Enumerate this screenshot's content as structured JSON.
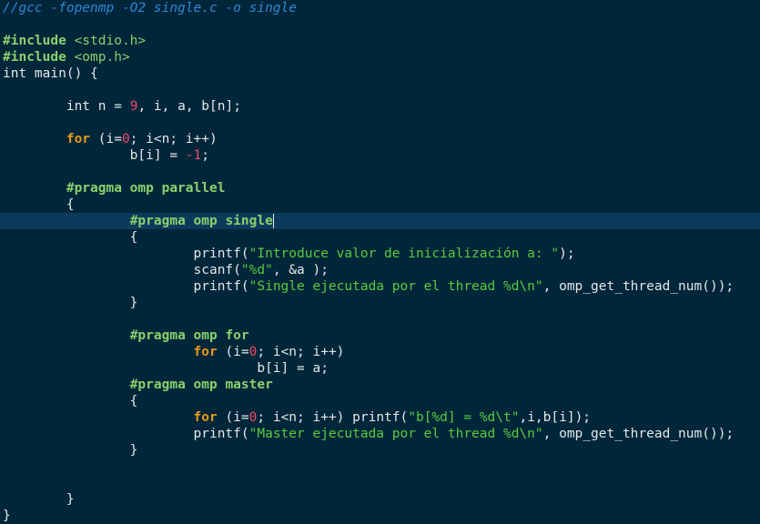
{
  "editor": {
    "lines": [
      [
        {
          "c": "comment",
          "t": "//gcc -fopenmp -O2 single.c -o single"
        }
      ],
      [],
      [
        {
          "c": "pre",
          "t": "#include "
        },
        {
          "c": "include-path",
          "t": "<stdio.h>"
        }
      ],
      [
        {
          "c": "pre",
          "t": "#include "
        },
        {
          "c": "include-path",
          "t": "<omp.h>"
        }
      ],
      [
        {
          "c": "type",
          "t": "int"
        },
        {
          "c": "plain",
          "t": " main() {"
        }
      ],
      [],
      [
        {
          "c": "plain",
          "t": "        "
        },
        {
          "c": "type",
          "t": "int"
        },
        {
          "c": "plain",
          "t": " n = "
        },
        {
          "c": "num",
          "t": "9"
        },
        {
          "c": "plain",
          "t": ", i, a, b[n];"
        }
      ],
      [],
      [
        {
          "c": "plain",
          "t": "        "
        },
        {
          "c": "kw",
          "t": "for"
        },
        {
          "c": "plain",
          "t": " (i="
        },
        {
          "c": "num",
          "t": "0"
        },
        {
          "c": "plain",
          "t": "; i<n; i++)"
        }
      ],
      [
        {
          "c": "plain",
          "t": "                b[i] = "
        },
        {
          "c": "num",
          "t": "-1"
        },
        {
          "c": "plain",
          "t": ";"
        }
      ],
      [],
      [
        {
          "c": "plain",
          "t": "        "
        },
        {
          "c": "pre",
          "t": "#pragma omp parallel"
        }
      ],
      [
        {
          "c": "plain",
          "t": "        {"
        }
      ],
      [
        {
          "c": "plain",
          "t": "                "
        },
        {
          "c": "pre",
          "t": "#pragma omp single"
        }
      ],
      [
        {
          "c": "plain",
          "t": "                {"
        }
      ],
      [
        {
          "c": "plain",
          "t": "                        printf("
        },
        {
          "c": "str",
          "t": "\"Introduce valor de inicialización a: \""
        },
        {
          "c": "plain",
          "t": ");"
        }
      ],
      [
        {
          "c": "plain",
          "t": "                        scanf("
        },
        {
          "c": "str",
          "t": "\"%d\""
        },
        {
          "c": "plain",
          "t": ", &a );"
        }
      ],
      [
        {
          "c": "plain",
          "t": "                        printf("
        },
        {
          "c": "str",
          "t": "\"Single ejecutada por el thread %d\\n\""
        },
        {
          "c": "plain",
          "t": ", omp_get_thread_num());"
        }
      ],
      [
        {
          "c": "plain",
          "t": "                }"
        }
      ],
      [],
      [
        {
          "c": "plain",
          "t": "                "
        },
        {
          "c": "pre",
          "t": "#pragma omp for"
        }
      ],
      [
        {
          "c": "plain",
          "t": "                        "
        },
        {
          "c": "kw",
          "t": "for"
        },
        {
          "c": "plain",
          "t": " (i="
        },
        {
          "c": "num",
          "t": "0"
        },
        {
          "c": "plain",
          "t": "; i<n; i++)"
        }
      ],
      [
        {
          "c": "plain",
          "t": "                                b[i] = a;"
        }
      ],
      [
        {
          "c": "plain",
          "t": "                "
        },
        {
          "c": "pre",
          "t": "#pragma omp master"
        }
      ],
      [
        {
          "c": "plain",
          "t": "                {"
        }
      ],
      [
        {
          "c": "plain",
          "t": "                        "
        },
        {
          "c": "kw",
          "t": "for"
        },
        {
          "c": "plain",
          "t": " (i="
        },
        {
          "c": "num",
          "t": "0"
        },
        {
          "c": "plain",
          "t": "; i<n; i++) printf("
        },
        {
          "c": "str",
          "t": "\"b[%d] = %d\\t\""
        },
        {
          "c": "plain",
          "t": ",i,b[i]);"
        }
      ],
      [
        {
          "c": "plain",
          "t": "                        printf("
        },
        {
          "c": "str",
          "t": "\"Master ejecutada por el thread %d\\n\""
        },
        {
          "c": "plain",
          "t": ", omp_get_thread_num());"
        }
      ],
      [
        {
          "c": "plain",
          "t": "                }"
        }
      ],
      [],
      [],
      [
        {
          "c": "plain",
          "t": "        }"
        }
      ],
      [
        {
          "c": "plain",
          "t": "}"
        }
      ]
    ],
    "current_line": 13,
    "colors": {
      "background": "#00263a",
      "current_line_highlight": "#0a3b5c",
      "comment": "#2f86d6",
      "preprocessor": "#8ad16b",
      "keyword": "#e89a1a",
      "number": "#f04a66",
      "string": "#58cc3e",
      "text": "#e4e8ea"
    }
  }
}
